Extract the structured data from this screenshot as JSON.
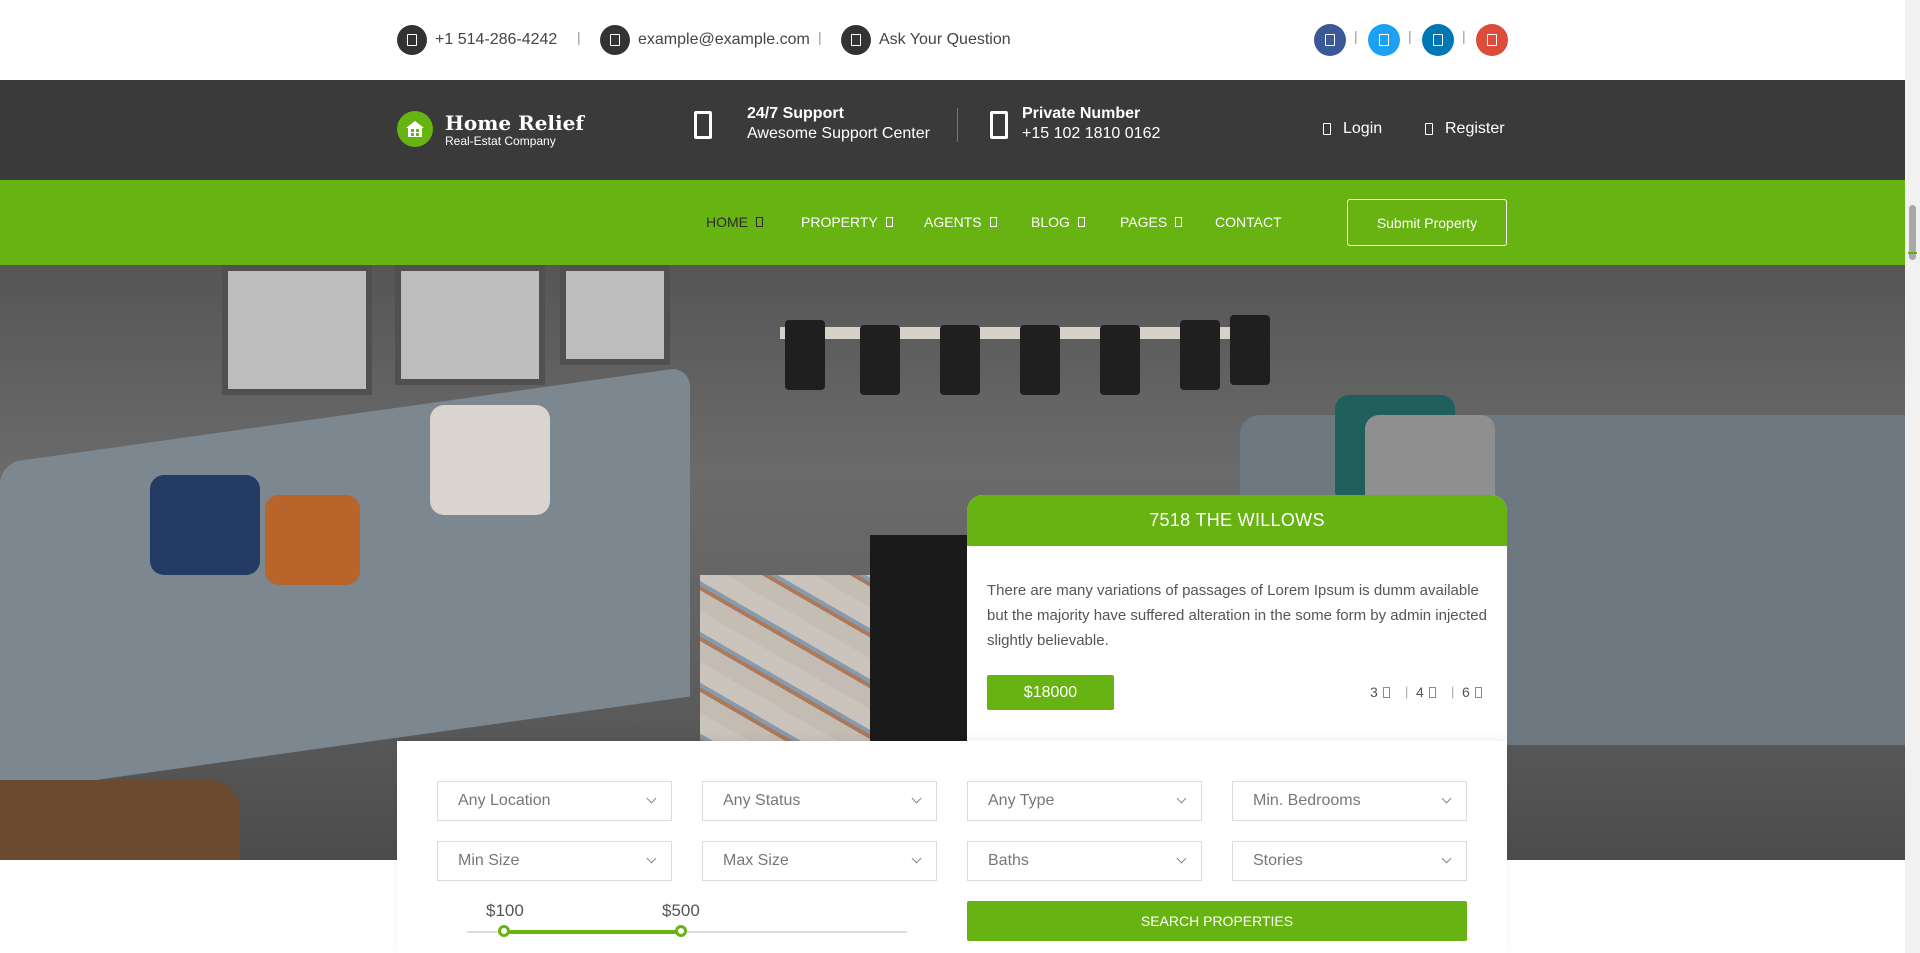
{
  "topbar": {
    "phone": "+1 514-286-4242",
    "email": "example@example.com",
    "question": "Ask Your Question",
    "social": [
      {
        "name": "facebook-icon",
        "color": "#3b5998"
      },
      {
        "name": "twitter-icon",
        "color": "#1da1f2"
      },
      {
        "name": "linkedin-icon",
        "color": "#0077b5"
      },
      {
        "name": "google-plus-icon",
        "color": "#dd4b39"
      }
    ]
  },
  "header": {
    "logo_title": "Home Relief",
    "logo_subtitle": "Real-Estat Company",
    "support_title": "24/7 Support",
    "support_sub": "Awesome Support Center",
    "private_title": "Private Number",
    "private_number": "+15 102 1810 0162",
    "login": "Login",
    "register": "Register"
  },
  "nav": {
    "items": [
      {
        "label": "HOME",
        "dropdown": true,
        "active": true
      },
      {
        "label": "PROPERTY",
        "dropdown": true
      },
      {
        "label": "AGENTS",
        "dropdown": true
      },
      {
        "label": "BLOG",
        "dropdown": true
      },
      {
        "label": "PAGES",
        "dropdown": true
      },
      {
        "label": "CONTACT",
        "dropdown": false
      }
    ],
    "submit": "Submit Property"
  },
  "card": {
    "title": "7518 THE WILLOWS",
    "description": "There are many variations of passages of Lorem Ipsum is dumm available but the majority have suffered alteration in the some form by admin injected slightly believable.",
    "price": "$18000",
    "features": [
      "3",
      "4",
      "6"
    ]
  },
  "search": {
    "selects": [
      "Any Location",
      "Any Status",
      "Any Type",
      "Min. Bedrooms",
      "Min Size",
      "Max Size",
      "Baths",
      "Stories"
    ],
    "price_min": "$100",
    "price_max": "$500",
    "button": "SEARCH PROPERTIES"
  },
  "colors": {
    "accent": "#66b311",
    "header_dark": "#3a3a3a"
  }
}
